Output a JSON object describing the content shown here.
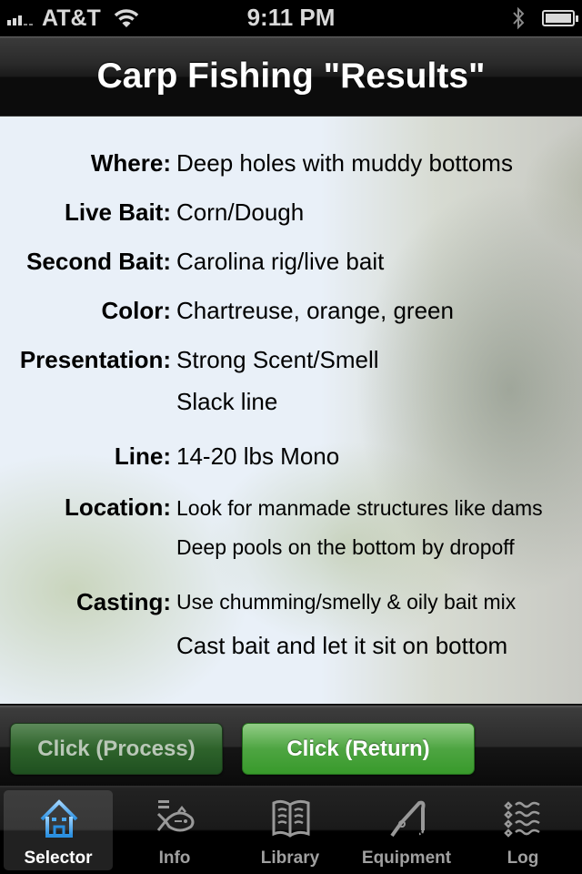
{
  "status_bar": {
    "carrier": "AT&T",
    "time": "9:11 PM",
    "icons": [
      "signal-icon",
      "wifi-icon",
      "bluetooth-icon",
      "battery-icon"
    ]
  },
  "nav_bar": {
    "title": "Carp Fishing \"Results\""
  },
  "results": [
    {
      "label": "Where:",
      "values": [
        "Deep holes with muddy bottoms"
      ]
    },
    {
      "label": "Live Bait:",
      "values": [
        "Corn/Dough"
      ]
    },
    {
      "label": "Second Bait:",
      "values": [
        "Carolina rig/live bait"
      ]
    },
    {
      "label": "Color:",
      "values": [
        "Chartreuse, orange, green"
      ]
    },
    {
      "label": "Presentation:",
      "values": [
        "Strong Scent/Smell",
        "Slack line"
      ]
    },
    {
      "label": "Line:",
      "values": [
        "14-20 lbs Mono"
      ]
    },
    {
      "label": "Location:",
      "values": [
        "Look for manmade structures like dams",
        "Deep pools on the bottom by dropoff"
      ]
    },
    {
      "label": "Casting:",
      "values": [
        "Use chumming/smelly & oily bait mix",
        "Cast bait and let it sit on bottom"
      ]
    }
  ],
  "buttons": {
    "process_label": "Click (Process)",
    "return_label": "Click (Return)"
  },
  "tab_bar": {
    "active": "Selector",
    "active_color": "#4aa8f0",
    "tabs": [
      {
        "label": "Selector",
        "icon": "house-icon"
      },
      {
        "label": "Info",
        "icon": "fish-icon"
      },
      {
        "label": "Library",
        "icon": "book-icon"
      },
      {
        "label": "Equipment",
        "icon": "fishing-rod-icon"
      },
      {
        "label": "Log",
        "icon": "waves-list-icon"
      }
    ]
  }
}
